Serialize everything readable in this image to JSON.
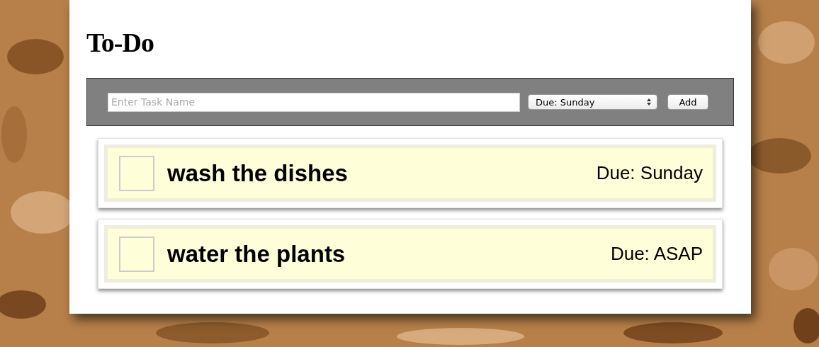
{
  "title": "To-Do",
  "new_task": {
    "placeholder": "Enter Task Name",
    "due_select": "Due: Sunday",
    "add_button": "Add"
  },
  "tasks": [
    {
      "name": "wash the dishes",
      "due": "Due: Sunday",
      "checked": false
    },
    {
      "name": "water the plants",
      "due": "Due: ASAP",
      "checked": false
    }
  ]
}
